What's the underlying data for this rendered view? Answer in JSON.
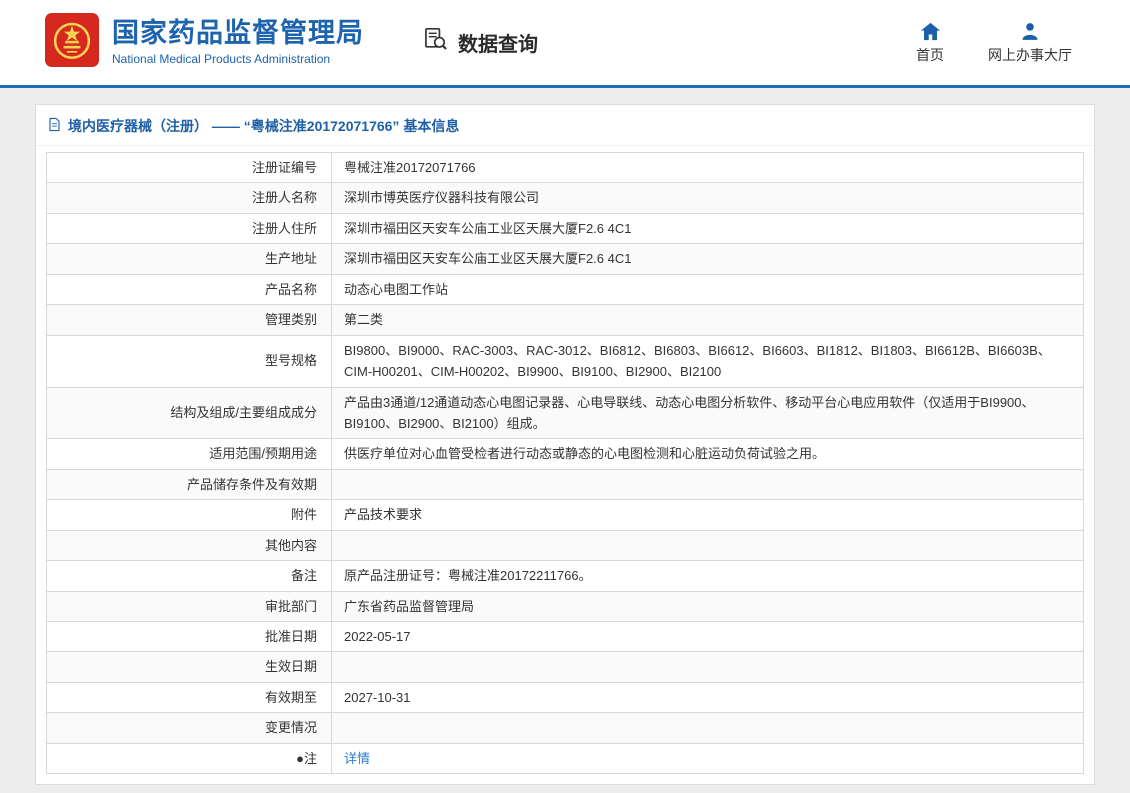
{
  "header": {
    "org_name_cn": "国家药品监督管理局",
    "org_name_en": "National Medical Products Administration",
    "nav_query": "数据查询",
    "nav_home": "首页",
    "nav_hall": "网上办事大厅"
  },
  "colors": {
    "brand_blue": "#1e63ae",
    "header_line": "#1b6fb8",
    "title_blue": "#2060a7",
    "link_blue": "#2e7cd0",
    "emblem_red": "#d6281e",
    "emblem_gold": "#f7d654"
  },
  "icons": {
    "emblem": "national-emblem",
    "query": "document-magnifier",
    "home": "house",
    "hall": "person",
    "panel": "document"
  },
  "panel": {
    "title": "境内医疗器械（注册） —— “粤械注准20172071766” 基本信息"
  },
  "table": {
    "rows": [
      {
        "label": "注册证编号",
        "value": "粤械注准20172071766"
      },
      {
        "label": "注册人名称",
        "value": "深圳市博英医疗仪器科技有限公司"
      },
      {
        "label": "注册人住所",
        "value": "深圳市福田区天安车公庙工业区天展大厦F2.6 4C1"
      },
      {
        "label": "生产地址",
        "value": "深圳市福田区天安车公庙工业区天展大厦F2.6 4C1"
      },
      {
        "label": "产品名称",
        "value": "动态心电图工作站"
      },
      {
        "label": "管理类别",
        "value": "第二类"
      },
      {
        "label": "型号规格",
        "value": "BI9800、BI9000、RAC-3003、RAC-3012、BI6812、BI6803、BI6612、BI6603、BI1812、BI1803、BI6612B、BI6603B、CIM-H00201、CIM-H00202、BI9900、BI9100、BI2900、BI2100"
      },
      {
        "label": "结构及组成/主要组成成分",
        "value": "产品由3通道/12通道动态心电图记录器、心电导联线、动态心电图分析软件、移动平台心电应用软件（仅适用于BI9900、BI9100、BI2900、BI2100）组成。"
      },
      {
        "label": "适用范围/预期用途",
        "value": "供医疗单位对心血管受检者进行动态或静态的心电图检测和心脏运动负荷试验之用。"
      },
      {
        "label": "产品储存条件及有效期",
        "value": ""
      },
      {
        "label": "附件",
        "value": "产品技术要求"
      },
      {
        "label": "其他内容",
        "value": ""
      },
      {
        "label": "备注",
        "value": "原产品注册证号：粤械注准20172211766。"
      },
      {
        "label": "审批部门",
        "value": "广东省药品监督管理局"
      },
      {
        "label": "批准日期",
        "value": "2022-05-17"
      },
      {
        "label": "生效日期",
        "value": ""
      },
      {
        "label": "有效期至",
        "value": "2027-10-31"
      },
      {
        "label": "变更情况",
        "value": ""
      },
      {
        "label": "●注",
        "value": "详情"
      }
    ]
  }
}
